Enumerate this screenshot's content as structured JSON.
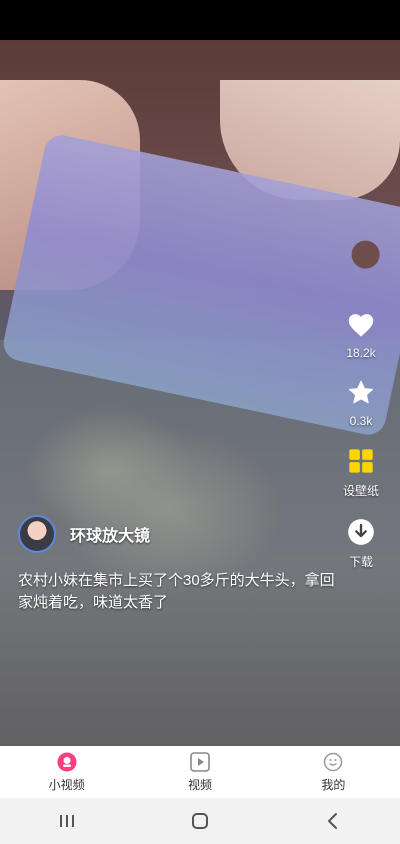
{
  "video": {
    "likes": "18.2k",
    "favorites": "0.3k",
    "wallpaper_label": "设壁纸",
    "download_label": "下载",
    "author_name": "环球放大镜",
    "caption": "农村小妹在集市上买了个30多斤的大牛头，拿回家炖着吃，味道太香了"
  },
  "tabs": [
    {
      "label": "小视频",
      "icon": "short-video-icon"
    },
    {
      "label": "视频",
      "icon": "video-play-icon"
    },
    {
      "label": "我的",
      "icon": "profile-icon"
    }
  ],
  "colors": {
    "accent_pink": "#ff3d7f",
    "wallpaper_yellow": "#ffd400"
  }
}
